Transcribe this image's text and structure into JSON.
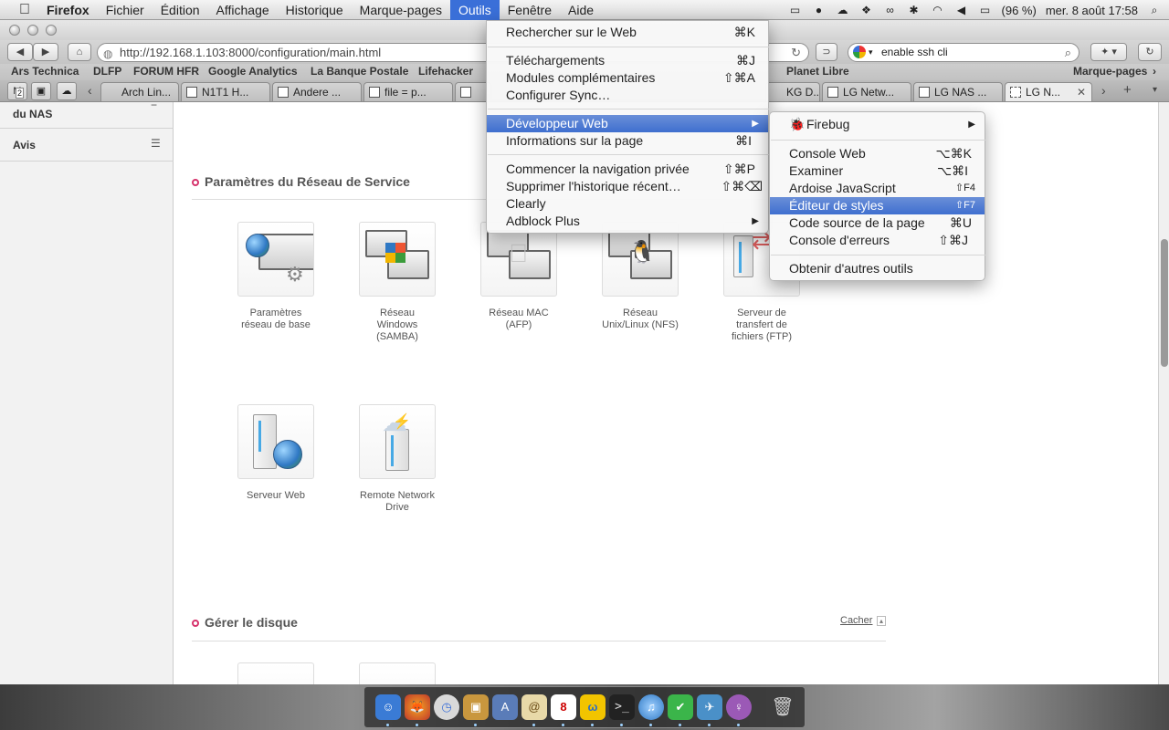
{
  "menubar": {
    "app": "Firefox",
    "items": [
      "Fichier",
      "Édition",
      "Affichage",
      "Historique",
      "Marque-pages",
      "Outils",
      "Fenêtre",
      "Aide"
    ],
    "battery": "(96 %)",
    "clock": "mer. 8 août 17:58"
  },
  "toolbar": {
    "url": "http://192.168.1.103:8000/configuration/main.html",
    "search_value": "enable ssh cli"
  },
  "bookmarks": {
    "items": [
      "Ars Technica",
      "DLFP",
      "FORUM HFR",
      "Google Analytics",
      "La Banque Postale",
      "Lifehacker",
      "Planet Libre"
    ],
    "menu": "Marque-pages"
  },
  "tabs": {
    "badge": "2",
    "items": [
      "Arch Lin...",
      "N1T1 H...",
      "Andere ...",
      "file = p...",
      "KG D...",
      "LG Netw...",
      "LG NAS ...",
      "LG N..."
    ]
  },
  "sidebar": {
    "items": [
      "du NAS",
      "Avis"
    ]
  },
  "content": {
    "section1": "Paramètres du Réseau de Service",
    "section2": "Gérer le disque",
    "hide_link": "Cacher",
    "tiles": [
      {
        "label": "Paramètres réseau de base"
      },
      {
        "label": "Réseau Windows (SAMBA)"
      },
      {
        "label": "Réseau MAC (AFP)"
      },
      {
        "label": "Réseau Unix/Linux (NFS)"
      },
      {
        "label": "Serveur de transfert de fichiers (FTP)"
      },
      {
        "label": "Serveur Web"
      },
      {
        "label": "Remote Network Drive"
      }
    ]
  },
  "tools_menu": {
    "items": [
      {
        "label": "Rechercher sur le Web",
        "shortcut": "⌘K"
      },
      {
        "label": "Téléchargements",
        "shortcut": "⌘J"
      },
      {
        "label": "Modules complémentaires",
        "shortcut": "⇧⌘A"
      },
      {
        "label": "Configurer Sync…",
        "shortcut": ""
      },
      {
        "label": "Développeur Web",
        "shortcut": ""
      },
      {
        "label": "Informations sur la page",
        "shortcut": "⌘I"
      },
      {
        "label": "Commencer la navigation privée",
        "shortcut": "⇧⌘P"
      },
      {
        "label": "Supprimer l'historique récent…",
        "shortcut": "⇧⌘⌫"
      },
      {
        "label": "Clearly",
        "shortcut": ""
      },
      {
        "label": "Adblock Plus",
        "shortcut": ""
      }
    ]
  },
  "dev_menu": {
    "items": [
      {
        "label": "Firebug",
        "shortcut": ""
      },
      {
        "label": "Console Web",
        "shortcut": "⌥⌘K"
      },
      {
        "label": "Examiner",
        "shortcut": "⌥⌘I"
      },
      {
        "label": "Ardoise JavaScript",
        "shortcut": "⇧F4"
      },
      {
        "label": "Éditeur de styles",
        "shortcut": "⇧F7"
      },
      {
        "label": "Code source de la page",
        "shortcut": "⌘U"
      },
      {
        "label": "Console d'erreurs",
        "shortcut": "⇧⌘J"
      },
      {
        "label": "Obtenir d'autres outils",
        "shortcut": ""
      }
    ]
  },
  "dock": {
    "calendar_day": "8"
  }
}
